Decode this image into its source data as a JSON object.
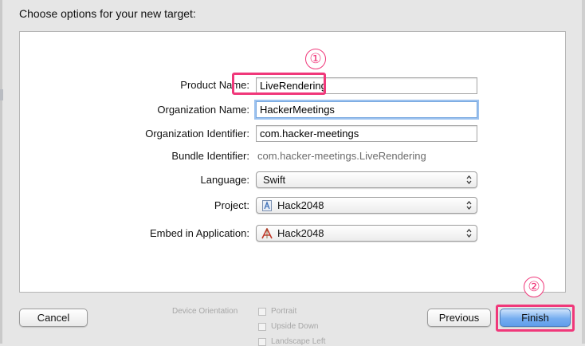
{
  "sheet": {
    "title": "Choose options for your new target:"
  },
  "form": {
    "product_name": {
      "label": "Product Name:",
      "value": "LiveRendering"
    },
    "organization_name": {
      "label": "Organization Name:",
      "value": "HackerMeetings"
    },
    "organization_identifier": {
      "label": "Organization Identifier:",
      "value": "com.hacker-meetings"
    },
    "bundle_identifier": {
      "label": "Bundle Identifier:",
      "value": "com.hacker-meetings.LiveRendering"
    },
    "language": {
      "label": "Language:",
      "value": "Swift"
    },
    "project": {
      "label": "Project:",
      "value": "Hack2048",
      "icon": "xcode-project-icon"
    },
    "embed_in_application": {
      "label": "Embed in Application:",
      "value": "Hack2048",
      "icon": "app-target-icon"
    }
  },
  "annotations": {
    "step1": "①",
    "step2": "②",
    "color": "#f0387a"
  },
  "buttons": {
    "cancel": "Cancel",
    "previous": "Previous",
    "finish": "Finish"
  },
  "background": {
    "device_orientation": "Device Orientation",
    "options": [
      "Portrait",
      "Upside Down",
      "Landscape Left"
    ]
  }
}
